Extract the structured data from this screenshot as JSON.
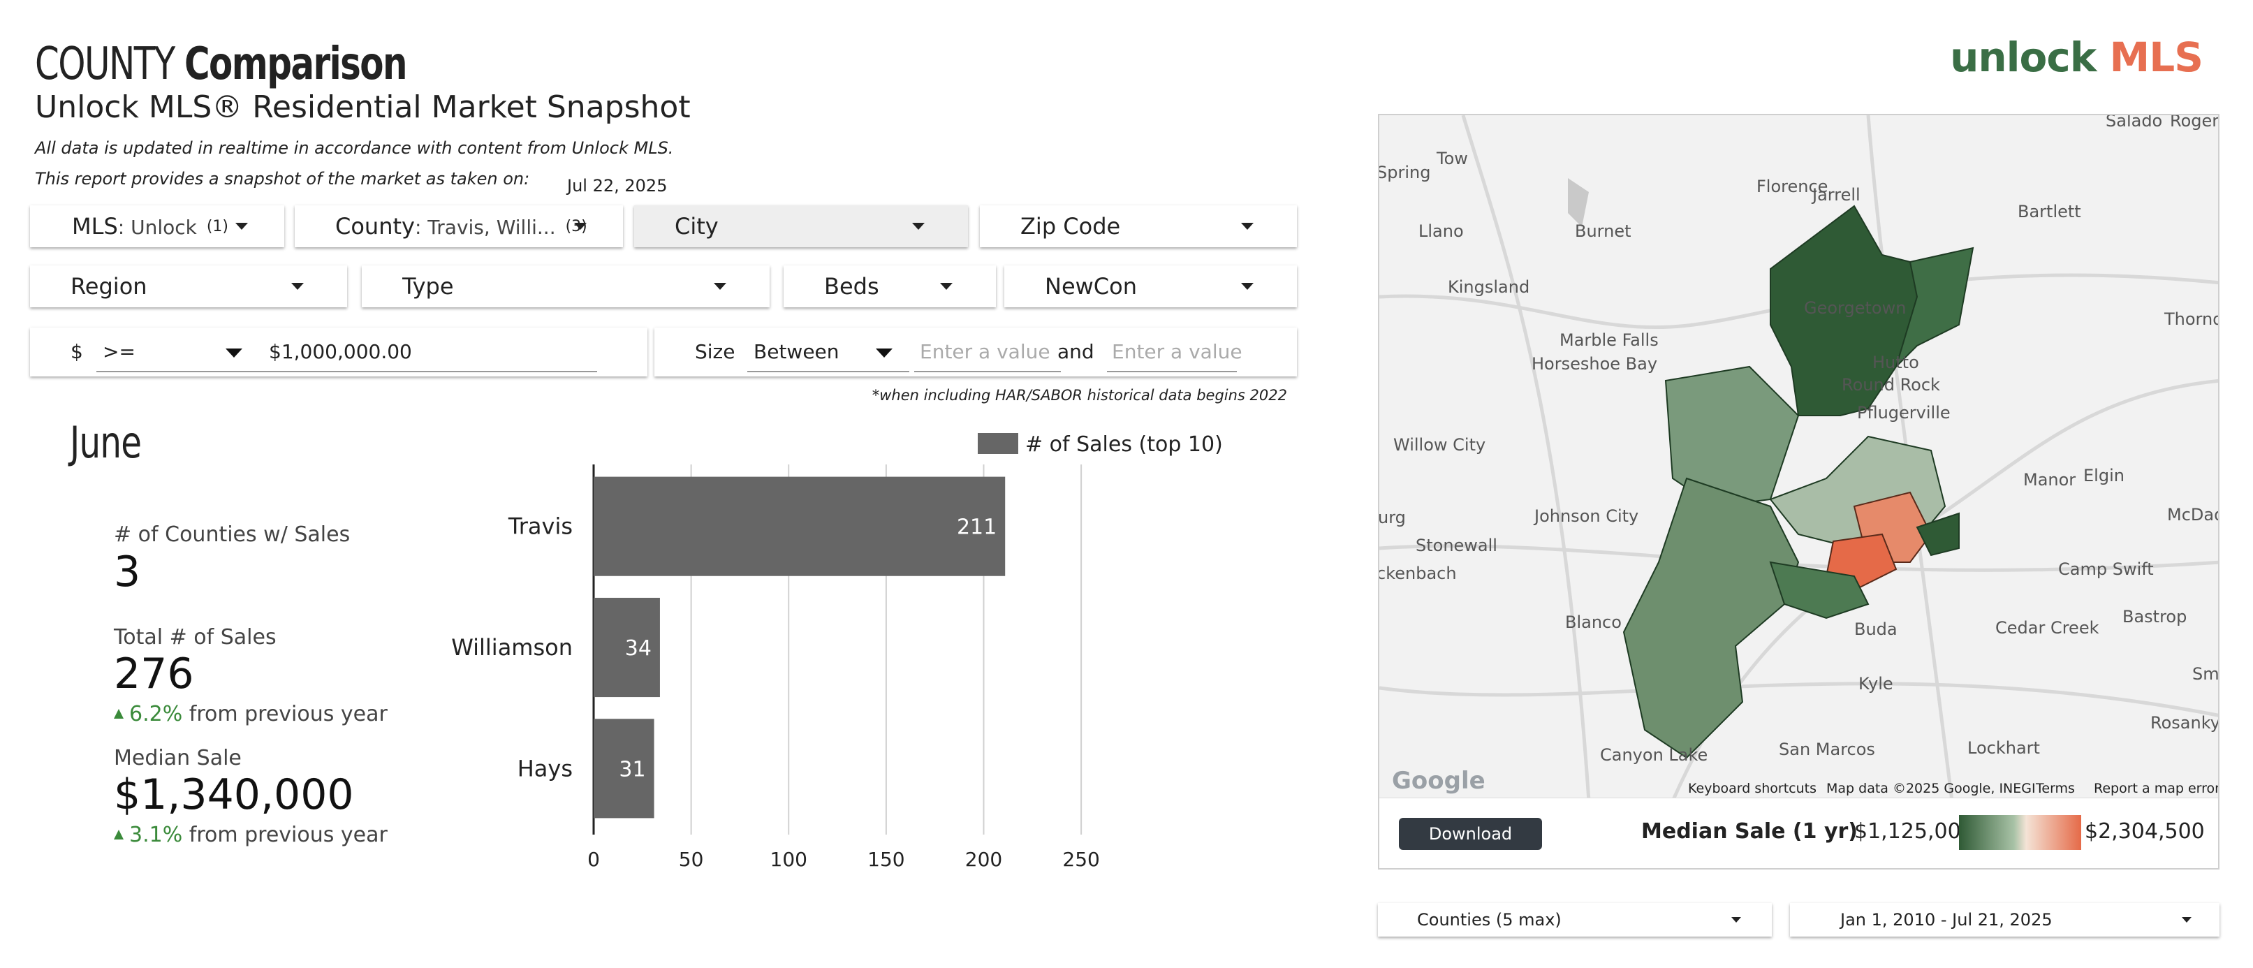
{
  "header": {
    "title_light": "COUNTY",
    "title_bold": "Comparison",
    "subtitle": "Unlock MLS® Residential Market Snapshot",
    "note1": "All data is updated in realtime in accordance with content from Unlock MLS.",
    "note2": "This report provides a snapshot of the market as taken on:",
    "snapshot_date": "Jul 22, 2025",
    "logo_a": "unlock",
    "logo_b": "MLS"
  },
  "filters": {
    "mls": {
      "label": "MLS",
      "value": ": Unlock",
      "count": "(1)"
    },
    "county": {
      "label": "County",
      "value": ": Travis, Willi...",
      "count": "(3)"
    },
    "city": {
      "label": "City"
    },
    "zip": {
      "label": "Zip Code"
    },
    "region": {
      "label": "Region"
    },
    "type": {
      "label": "Type"
    },
    "beds": {
      "label": "Beds"
    },
    "newcon": {
      "label": "NewCon"
    },
    "price": {
      "currency": "$",
      "operator": ">=",
      "value": "$1,000,000.00"
    },
    "size": {
      "label": "Size",
      "operator": "Between",
      "min_placeholder": "Enter a value",
      "and": "and",
      "max_placeholder": "Enter a value"
    },
    "footnote": "*when including HAR/SABOR historical data begins 2022"
  },
  "summary": {
    "month": "June",
    "counties_label": "# of Counties w/ Sales",
    "counties_value": "3",
    "sales_label": "Total # of Sales",
    "sales_value": "276",
    "sales_change_pct": "6.2%",
    "sales_change_text": "from previous year",
    "median_label": "Median Sale",
    "median_value": "$1,340,000",
    "median_change_pct": "3.1%",
    "median_change_text": "from previous year"
  },
  "chart_data": {
    "type": "bar",
    "orientation": "horizontal",
    "categories": [
      "Travis",
      "Williamson",
      "Hays"
    ],
    "series": [
      {
        "name": "# of Sales (top 10)",
        "values": [
          211,
          34,
          31
        ]
      }
    ],
    "xlim": [
      0,
      265
    ],
    "xticks": [
      0,
      50,
      100,
      150,
      200,
      250
    ],
    "grid": true,
    "legend": "top-right",
    "bar_color": "#666666"
  },
  "map": {
    "labels": [
      "Salado",
      "Rogers",
      "Tow",
      "Spring",
      "Florence",
      "Jarrell",
      "Llano",
      "Burnet",
      "Bartlett",
      "Kingsland",
      "Georgetown",
      "Thorndale",
      "Marble Falls",
      "Horseshoe Bay",
      "Hutto",
      "Round Rock",
      "Pflugerville",
      "Willow City",
      "Elgin",
      "Manor",
      "Johnson City",
      "McDade",
      "urg",
      "Stonewall",
      "ckenbach",
      "Camp Swift",
      "Blanco",
      "Buda",
      "Cedar Creek",
      "Bastrop",
      "Smit",
      "Kyle",
      "Rosanky",
      "Canyon Lake",
      "San Marcos",
      "Lockhart"
    ],
    "attribution": {
      "shortcuts": "Keyboard shortcuts",
      "data": "Map data ©2025 Google, INEGI",
      "terms": "Terms",
      "report": "Report a map error",
      "google": "Google"
    },
    "download_label": "Download",
    "legend_title": "Median Sale (1 yr)",
    "legend_min": "$1,125,000",
    "legend_max": "$2,304,500",
    "colors": {
      "low": "#2f5a35",
      "mid": "#f4e3d6",
      "high": "#e56a48"
    }
  },
  "bottom_controls": {
    "counties": "Counties (5 max)",
    "date_range": "Jan 1, 2010 - Jul 21, 2025"
  }
}
